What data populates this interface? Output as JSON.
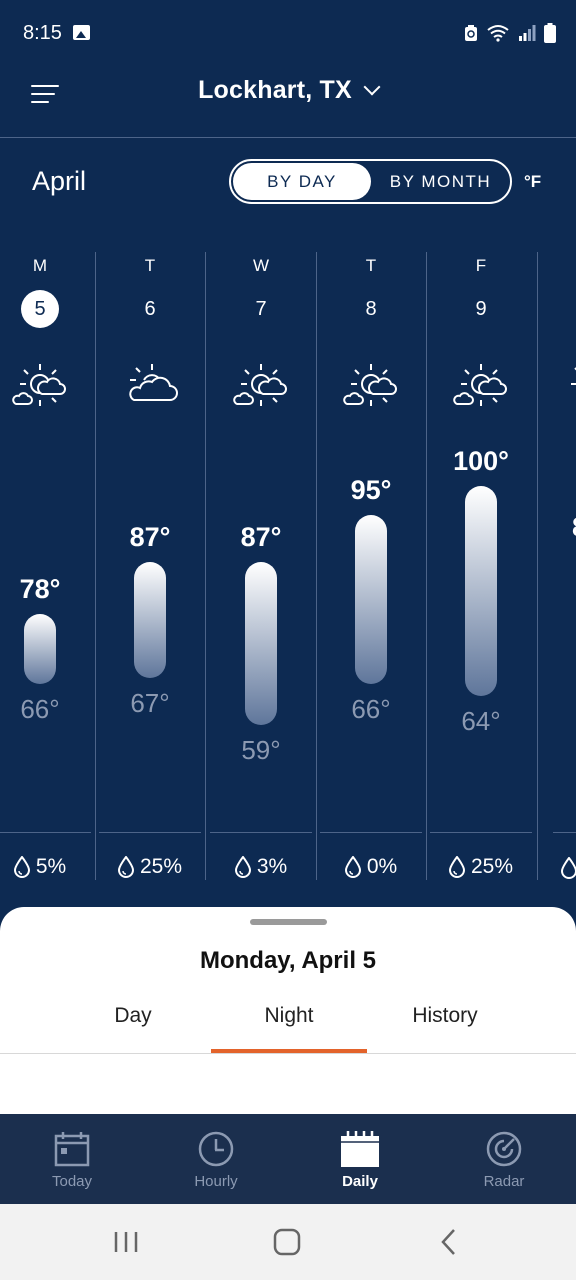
{
  "status_bar": {
    "time": "8:15",
    "icons": [
      "gallery-icon",
      "battery-saver-icon",
      "wifi-icon",
      "signal-icon",
      "battery-icon"
    ]
  },
  "header": {
    "location": "Lockhart, TX"
  },
  "controls": {
    "month": "April",
    "by_day_label": "BY DAY",
    "by_month_label": "BY MONTH",
    "unit": "°F"
  },
  "days": [
    {
      "dow": "M",
      "date": "5",
      "selected": true,
      "icon": "partly-cloudy-icon",
      "high": "78°",
      "low": "66°",
      "precip": "5%",
      "high_f": 78,
      "low_f": 66
    },
    {
      "dow": "T",
      "date": "6",
      "selected": false,
      "icon": "mostly-cloudy-icon",
      "high": "87°",
      "low": "67°",
      "precip": "25%",
      "high_f": 87,
      "low_f": 67
    },
    {
      "dow": "W",
      "date": "7",
      "selected": false,
      "icon": "partly-cloudy-icon",
      "high": "87°",
      "low": "59°",
      "precip": "3%",
      "high_f": 87,
      "low_f": 59
    },
    {
      "dow": "T",
      "date": "8",
      "selected": false,
      "icon": "partly-cloudy-icon",
      "high": "95°",
      "low": "66°",
      "precip": "0%",
      "high_f": 95,
      "low_f": 66
    },
    {
      "dow": "F",
      "date": "9",
      "selected": false,
      "icon": "partly-cloudy-icon",
      "high": "100°",
      "low": "64°",
      "precip": "25%",
      "high_f": 100,
      "low_f": 64
    }
  ],
  "sheet": {
    "title": "Monday, April 5",
    "tabs": [
      "Day",
      "Night",
      "History"
    ],
    "active_tab": "Night"
  },
  "bottom_nav": {
    "items": [
      {
        "label": "Today",
        "icon": "calendar-day-icon",
        "active": false
      },
      {
        "label": "Hourly",
        "icon": "clock-icon",
        "active": false
      },
      {
        "label": "Daily",
        "icon": "calendar-icon",
        "active": true
      },
      {
        "label": "Radar",
        "icon": "radar-icon",
        "active": false
      }
    ]
  },
  "colors": {
    "background": "#0d2a52",
    "accent": "#e3632b",
    "nav_background": "#1b2f4e"
  }
}
